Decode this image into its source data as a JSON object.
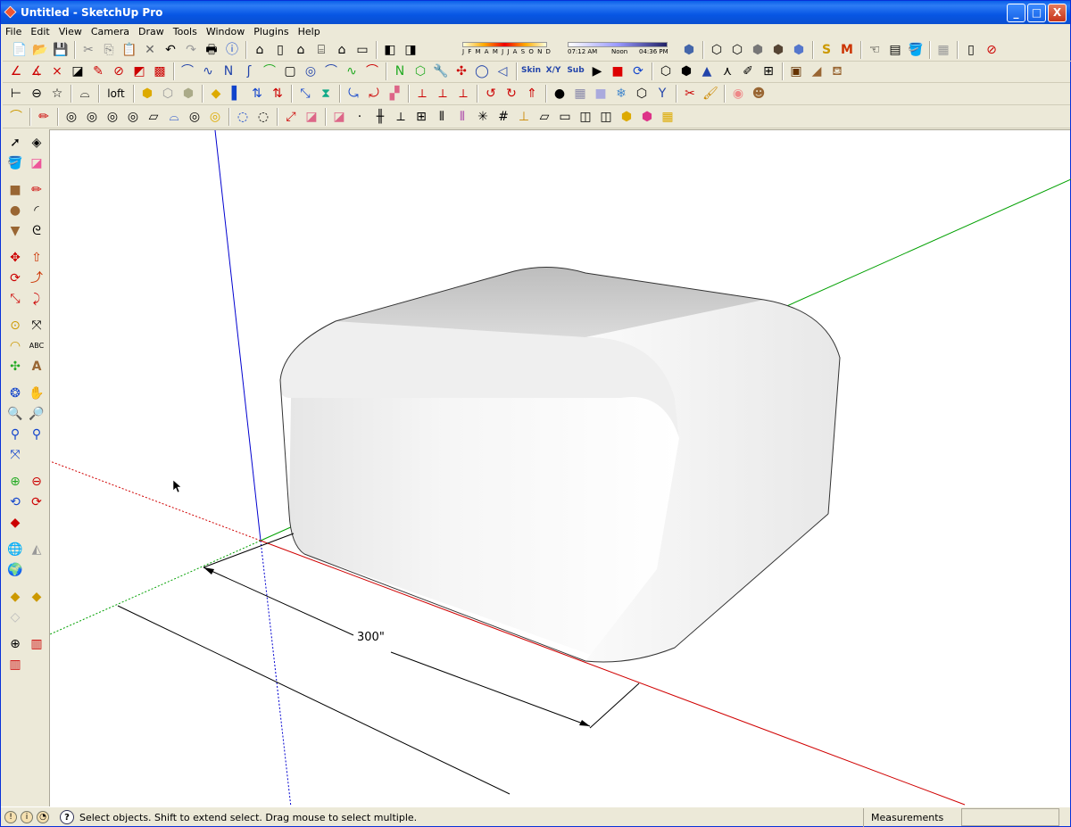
{
  "window": {
    "title": "Untitled - SketchUp Pro",
    "buttons": [
      "_",
      "□",
      "X"
    ]
  },
  "menu": [
    "File",
    "Edit",
    "View",
    "Camera",
    "Draw",
    "Tools",
    "Window",
    "Plugins",
    "Help"
  ],
  "shadow_settings": {
    "months": "J F M A M J J A S O N D",
    "time_start": "07:12 AM",
    "time_mid": "Noon",
    "time_end": "04:36 PM"
  },
  "toolbar_text": {
    "loft": "loft",
    "skin": "Skin",
    "xy": "X/Y",
    "sub": "Sub"
  },
  "toolbar_row1": [
    "new-icon",
    "open-icon",
    "save-icon",
    "cut-icon",
    "copy-icon",
    "paste-icon",
    "erase-icon",
    "undo-icon",
    "redo-icon",
    "print-icon",
    "model-info-icon",
    "iso-view-icon",
    "top-view-icon",
    "front-view-icon",
    "right-view-icon",
    "back-view-icon",
    "left-view-icon",
    "shadows-icon",
    "fog-icon"
  ],
  "toolbar_row1_right": [
    "xray-icon",
    "wireframe-icon",
    "hidden-line-icon",
    "shaded-icon",
    "shaded-texture-icon",
    "monochrome-icon",
    "sandbox-s-icon",
    "sandbox-m-icon",
    "hand-icon",
    "layers-icon",
    "paint-bucket-icon",
    "components-icon",
    "scene-icon",
    "no-entry-icon"
  ],
  "toolbar_row2_count": 38,
  "toolbar_row3_count": 42,
  "toolbar_row4_count": 33,
  "left_tools": [
    [
      "select-icon",
      "make-component-icon"
    ],
    [
      "paint-bucket-icon",
      "eraser-icon"
    ],
    [],
    [
      "rectangle-icon",
      "line-icon"
    ],
    [
      "circle-icon",
      "arc-icon"
    ],
    [
      "polygon-icon",
      "freehand-icon"
    ],
    [],
    [
      "move-icon",
      "push-pull-icon"
    ],
    [
      "rotate-icon",
      "follow-me-icon"
    ],
    [
      "scale-icon",
      "offset-icon"
    ],
    [],
    [
      "tape-measure-icon",
      "dimension-icon"
    ],
    [
      "protractor-icon",
      "text-icon"
    ],
    [
      "axes-icon",
      "3d-text-icon"
    ],
    [],
    [
      "orbit-icon",
      "pan-icon"
    ],
    [
      "zoom-icon",
      "zoom-window-icon"
    ],
    [
      "previous-view-icon",
      "next-view-icon"
    ],
    [
      "zoom-extents-icon"
    ],
    [],
    [
      "add-location-icon",
      "toggle-terrain-icon"
    ],
    [
      "get-models-icon",
      "share-model-icon"
    ],
    [
      "share-component-icon"
    ],
    [],
    [
      "google-earth-icon",
      "photo-texture-icon"
    ],
    [
      "preview-earth-icon"
    ],
    [],
    [
      "section-plane-icon",
      "display-sections-icon"
    ],
    [
      "section-cuts-icon"
    ],
    [],
    [
      "position-camera-icon",
      "walk-icon"
    ],
    [
      "look-around-icon"
    ]
  ],
  "viewport": {
    "dimension_label": "300\""
  },
  "status": {
    "message": "Select objects. Shift to extend select. Drag mouse to select multiple.",
    "measurements_label": "Measurements",
    "measurements_value": ""
  },
  "colors": {
    "axis_red": "#d00000",
    "axis_green": "#00a000",
    "axis_blue": "#0000d0",
    "title_blue": "#0a5fe8",
    "chrome": "#ece9d8"
  }
}
